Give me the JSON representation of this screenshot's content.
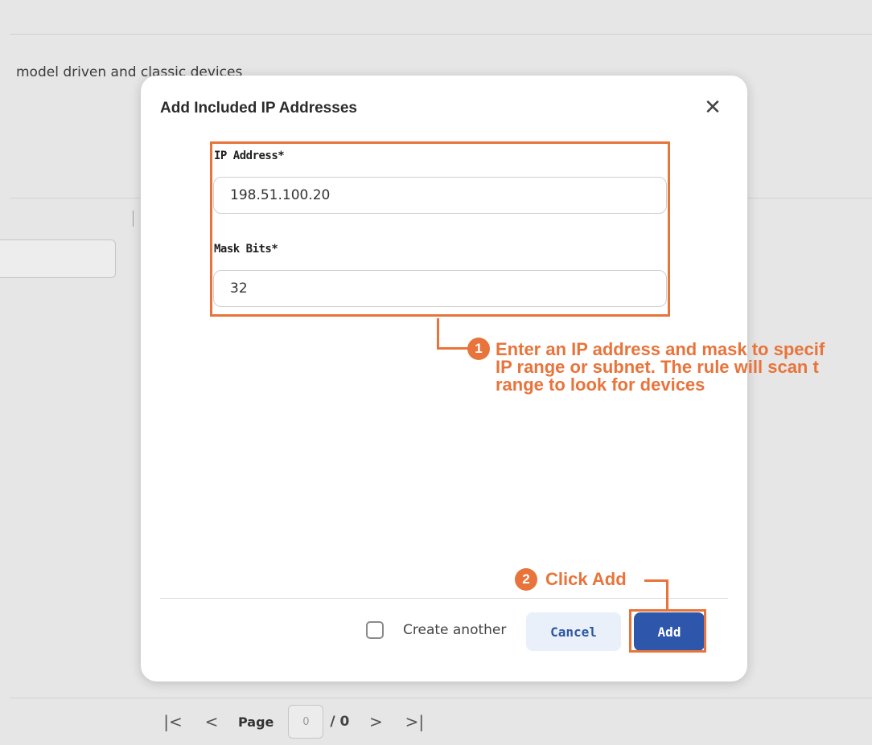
{
  "background": {
    "description": "model driven and classic devices",
    "pagination": {
      "first_icon": "first-page-icon",
      "prev_icon": "prev-page-icon",
      "page_label": "Page",
      "page_value": "0",
      "page_total": "/ 0",
      "next_icon": "next-page-icon",
      "last_icon": "last-page-icon"
    }
  },
  "modal": {
    "title": "Add Included IP Addresses",
    "close_icon": "close-icon",
    "fields": {
      "ip_label": "IP Address*",
      "ip_value": "198.51.100.20",
      "mask_label": "Mask Bits*",
      "mask_value": "32"
    },
    "footer": {
      "create_another_label": "Create another",
      "create_another_checked": false,
      "cancel_label": "Cancel",
      "add_label": "Add"
    }
  },
  "callouts": [
    {
      "number": "1",
      "text": "Enter an IP address and mask to specif\nIP range or subnet. The rule will scan t\nrange to look for devices"
    },
    {
      "number": "2",
      "text": "Click Add"
    }
  ],
  "colors": {
    "accent": "#e8743b",
    "primary": "#2e57ac",
    "cancel_bg": "#eaf0fa"
  }
}
